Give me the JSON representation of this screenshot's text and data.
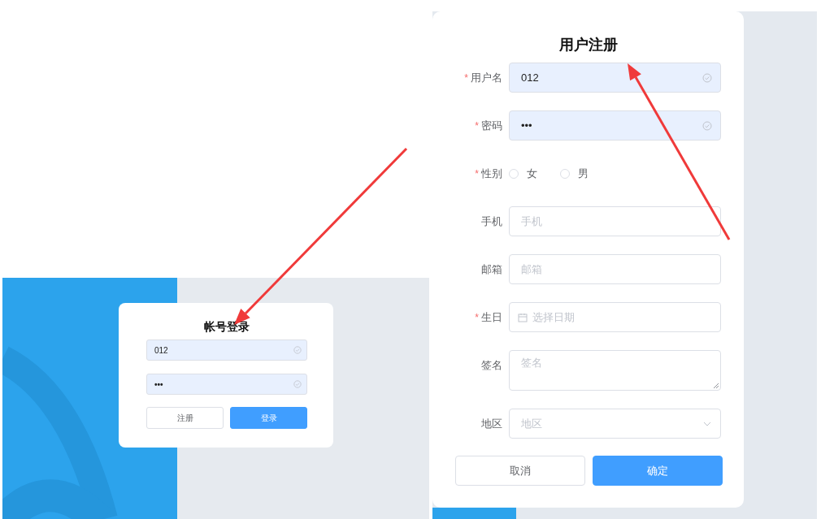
{
  "login": {
    "title": "帐号登录",
    "fields": [
      {
        "kind": "text",
        "value": "012",
        "autofilled": true,
        "valid": true
      },
      {
        "kind": "password",
        "value": "•••",
        "autofilled": true,
        "valid": true
      }
    ],
    "buttons": [
      {
        "label": "注册",
        "kind": "default"
      },
      {
        "label": "登录",
        "kind": "primary"
      }
    ]
  },
  "register": {
    "title": "用户注册",
    "fields": [
      {
        "kind": "input",
        "label": "用户名",
        "required_mark": "*",
        "value": "012",
        "autofilled": true,
        "valid": true
      },
      {
        "kind": "input",
        "label": "密码",
        "required_mark": "*",
        "value": "•••",
        "autofilled": true,
        "valid": true
      },
      {
        "kind": "radio",
        "label": "性别",
        "required_mark": "*",
        "options": [
          {
            "label": "女",
            "selected": false
          },
          {
            "label": "男",
            "selected": false
          }
        ]
      },
      {
        "kind": "input",
        "label": "手机",
        "placeholder": "手机",
        "autofilled": false,
        "valid": false
      },
      {
        "kind": "input",
        "label": "邮箱",
        "placeholder": "邮箱",
        "autofilled": false,
        "valid": false
      },
      {
        "kind": "date",
        "label": "生日",
        "required_mark": "*",
        "placeholder": "选择日期"
      },
      {
        "kind": "textarea",
        "label": "签名",
        "placeholder": "签名"
      },
      {
        "kind": "select",
        "label": "地区",
        "placeholder": "地区"
      }
    ],
    "buttons": [
      {
        "label": "取消",
        "kind": "default"
      },
      {
        "label": "确定",
        "kind": "primary"
      }
    ]
  }
}
